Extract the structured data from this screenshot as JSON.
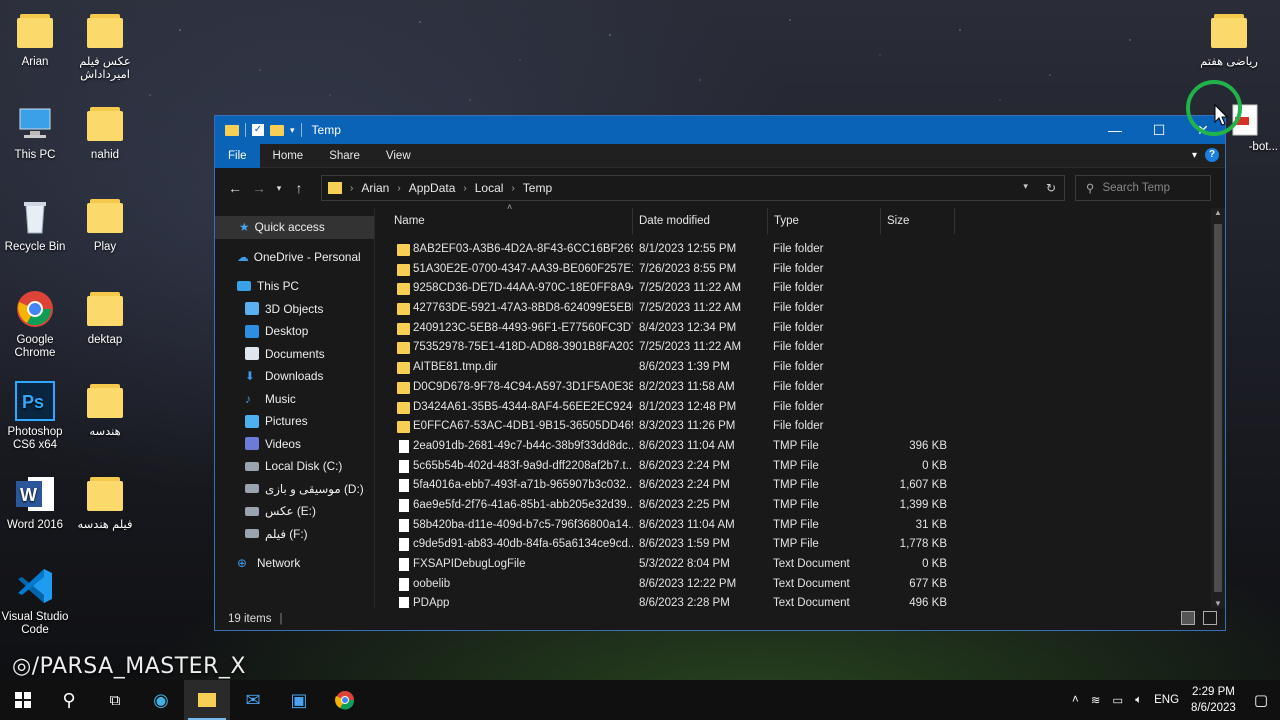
{
  "desktop": {
    "left_icons": [
      {
        "label": "Arian"
      },
      {
        "label": "This PC"
      },
      {
        "label": "Recycle Bin"
      },
      {
        "label": "Google Chrome"
      },
      {
        "label": "Photoshop CS6 x64"
      },
      {
        "label": "Word 2016"
      },
      {
        "label": "Visual Studio Code"
      }
    ],
    "second_icons": [
      {
        "label": "عکس فیلم امیرداداش"
      },
      {
        "label": "nahid"
      },
      {
        "label": "Play"
      },
      {
        "label": "dektap"
      },
      {
        "label": "هندسه"
      },
      {
        "label": "فیلم هندسه"
      }
    ],
    "right_icons": [
      {
        "label": "ریاضی هفتم"
      },
      {
        "label": "-bot..."
      }
    ],
    "watermark": "/PARSA_MASTER_X"
  },
  "window": {
    "title": "Temp",
    "ribbon_tabs": [
      "File",
      "Home",
      "Share",
      "View"
    ],
    "breadcrumb": [
      "Arian",
      "AppData",
      "Local",
      "Temp"
    ],
    "search_placeholder": "Search Temp",
    "nav": {
      "quick_access": "Quick access",
      "onedrive": "OneDrive - Personal",
      "this_pc": "This PC",
      "pc_items": [
        "3D Objects",
        "Desktop",
        "Documents",
        "Downloads",
        "Music",
        "Pictures",
        "Videos",
        "Local Disk (C:)",
        "موسیقی و بازی (D:)",
        "عکس (E:)",
        "فیلم (F:)"
      ],
      "network": "Network"
    },
    "columns": {
      "name": "Name",
      "date": "Date modified",
      "type": "Type",
      "size": "Size"
    },
    "files": [
      {
        "name": "8AB2EF03-A3B6-4D2A-8F43-6CC16BF269...",
        "date": "8/1/2023 12:55 PM",
        "type": "File folder",
        "size": "",
        "kind": "folder"
      },
      {
        "name": "51A30E2E-0700-4347-AA39-BE060F257E17",
        "date": "7/26/2023 8:55 PM",
        "type": "File folder",
        "size": "",
        "kind": "folder"
      },
      {
        "name": "9258CD36-DE7D-44AA-970C-18E0FF8A94...",
        "date": "7/25/2023 11:22 AM",
        "type": "File folder",
        "size": "",
        "kind": "folder"
      },
      {
        "name": "427763DE-5921-47A3-8BD8-624099E5EBB3",
        "date": "7/25/2023 11:22 AM",
        "type": "File folder",
        "size": "",
        "kind": "folder"
      },
      {
        "name": "2409123C-5EB8-4493-96F1-E77560FC3D72",
        "date": "8/4/2023 12:34 PM",
        "type": "File folder",
        "size": "",
        "kind": "folder"
      },
      {
        "name": "75352978-75E1-418D-AD88-3901B8FA203C",
        "date": "7/25/2023 11:22 AM",
        "type": "File folder",
        "size": "",
        "kind": "folder"
      },
      {
        "name": "AITBE81.tmp.dir",
        "date": "8/6/2023 1:39 PM",
        "type": "File folder",
        "size": "",
        "kind": "folder"
      },
      {
        "name": "D0C9D678-9F78-4C94-A597-3D1F5A0E3842",
        "date": "8/2/2023 11:58 AM",
        "type": "File folder",
        "size": "",
        "kind": "folder"
      },
      {
        "name": "D3424A61-35B5-4344-8AF4-56EE2EC92400",
        "date": "8/1/2023 12:48 PM",
        "type": "File folder",
        "size": "",
        "kind": "folder"
      },
      {
        "name": "E0FFCA67-53AC-4DB1-9B15-36505DD469...",
        "date": "8/3/2023 11:26 PM",
        "type": "File folder",
        "size": "",
        "kind": "folder"
      },
      {
        "name": "2ea091db-2681-49c7-b44c-38b9f33dd8dc...",
        "date": "8/6/2023 11:04 AM",
        "type": "TMP File",
        "size": "396 KB",
        "kind": "doc"
      },
      {
        "name": "5c65b54b-402d-483f-9a9d-dff2208af2b7.t...",
        "date": "8/6/2023 2:24 PM",
        "type": "TMP File",
        "size": "0 KB",
        "kind": "doc"
      },
      {
        "name": "5fa4016a-ebb7-493f-a71b-965907b3c032...",
        "date": "8/6/2023 2:24 PM",
        "type": "TMP File",
        "size": "1,607 KB",
        "kind": "doc"
      },
      {
        "name": "6ae9e5fd-2f76-41a6-85b1-abb205e32d39...",
        "date": "8/6/2023 2:25 PM",
        "type": "TMP File",
        "size": "1,399 KB",
        "kind": "doc"
      },
      {
        "name": "58b420ba-d11e-409d-b7c5-796f36800a14...",
        "date": "8/6/2023 11:04 AM",
        "type": "TMP File",
        "size": "31 KB",
        "kind": "doc"
      },
      {
        "name": "c9de5d91-ab83-40db-84fa-65a6134ce9cd...",
        "date": "8/6/2023 1:59 PM",
        "type": "TMP File",
        "size": "1,778 KB",
        "kind": "doc"
      },
      {
        "name": "FXSAPIDebugLogFile",
        "date": "5/3/2022 8:04 PM",
        "type": "Text Document",
        "size": "0 KB",
        "kind": "doc"
      },
      {
        "name": "oobelib",
        "date": "8/6/2023 12:22 PM",
        "type": "Text Document",
        "size": "677 KB",
        "kind": "doc"
      },
      {
        "name": "PDApp",
        "date": "8/6/2023 2:28 PM",
        "type": "Text Document",
        "size": "496 KB",
        "kind": "doc"
      }
    ],
    "status": "19 items"
  },
  "taskbar": {
    "language": "ENG",
    "time": "2:29 PM",
    "date": "8/6/2023"
  },
  "colors": {
    "accent": "#0b63b8",
    "folder": "#f7cf55",
    "window_bg": "#191919"
  }
}
